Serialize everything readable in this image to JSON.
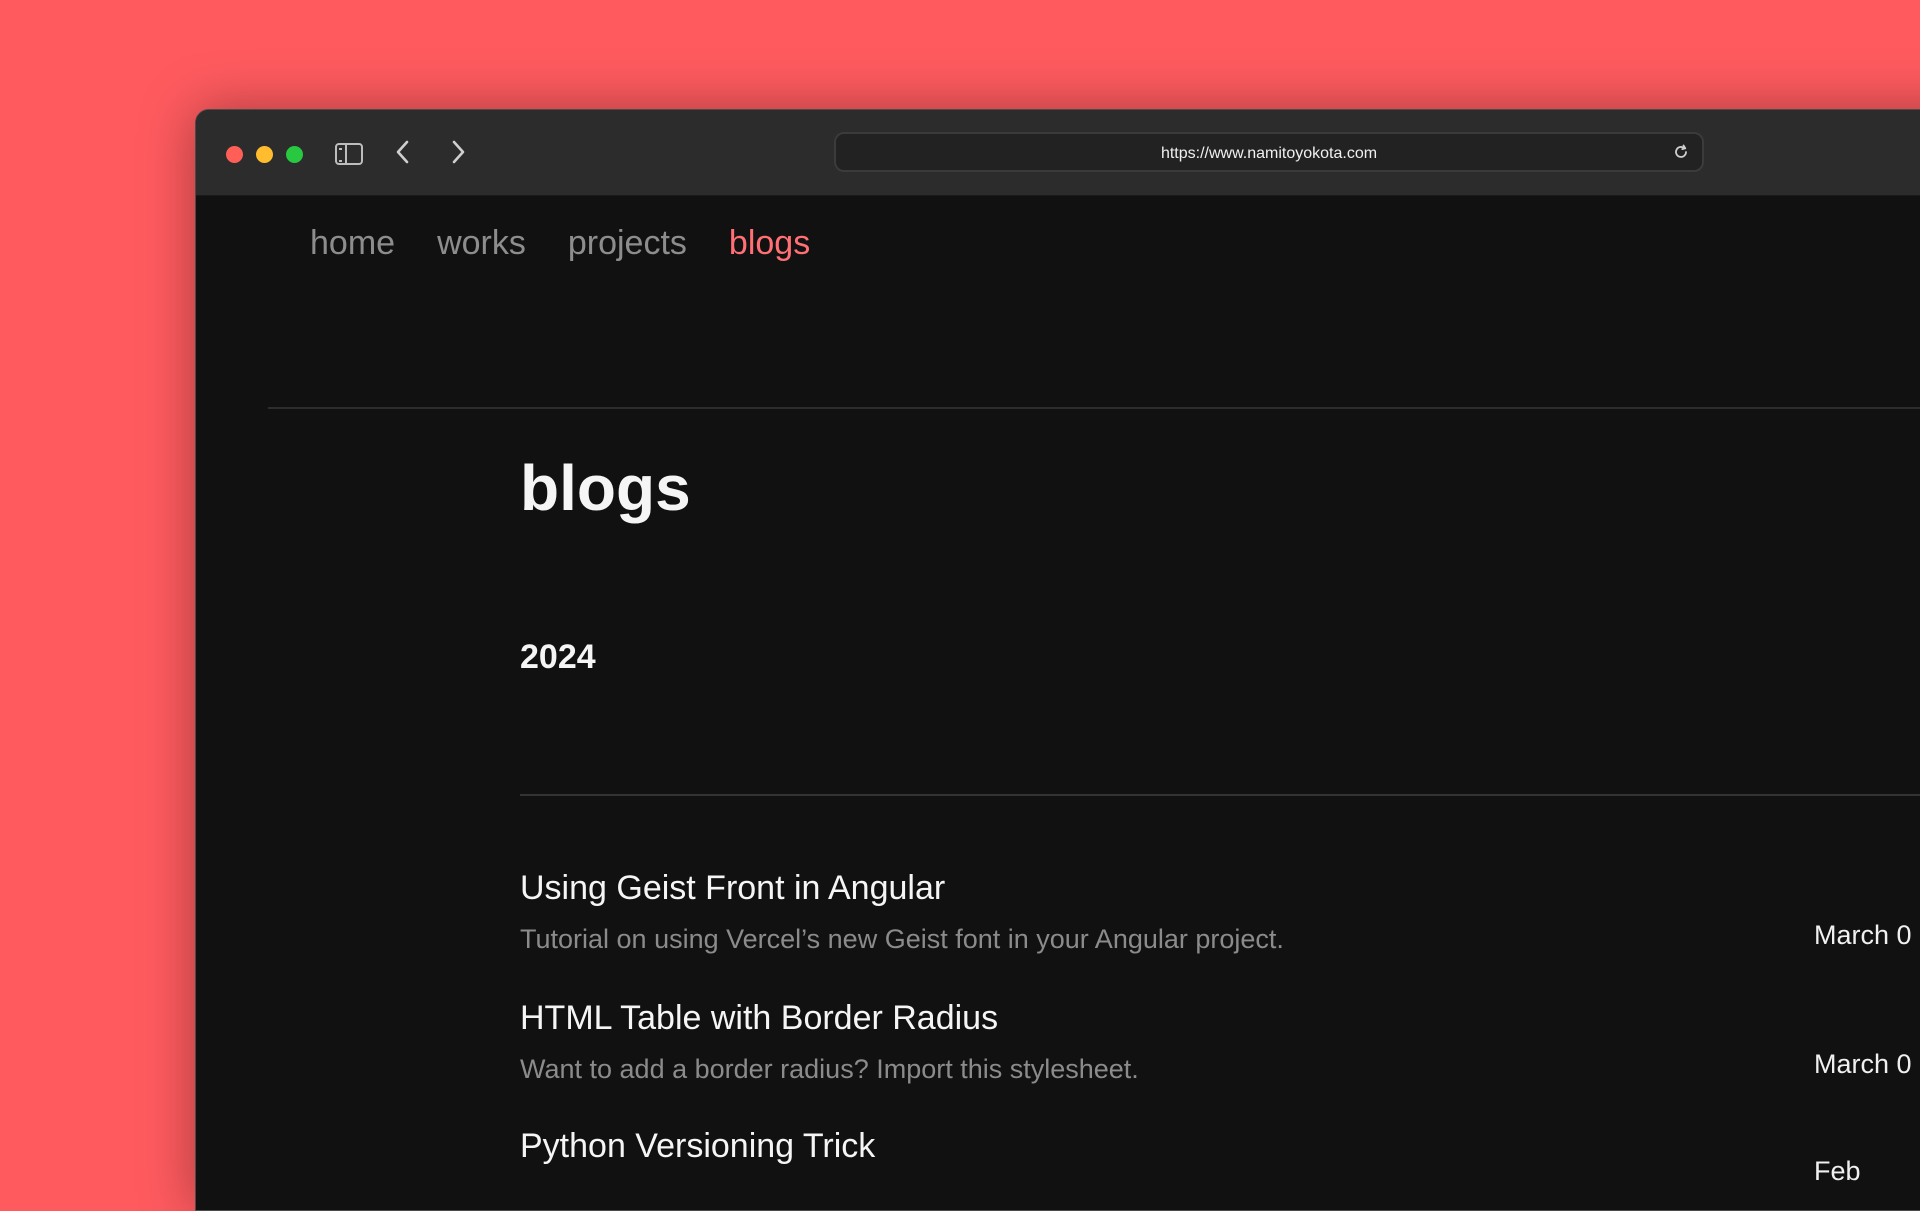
{
  "browser": {
    "url": "https://www.namitoyokota.com",
    "icons": [
      "sidebar-icon",
      "back-icon",
      "forward-icon",
      "reload-icon"
    ]
  },
  "nav": {
    "items": [
      {
        "label": "home"
      },
      {
        "label": "works"
      },
      {
        "label": "projects"
      },
      {
        "label": "blogs"
      }
    ],
    "active": "blogs"
  },
  "page": {
    "title": "blogs",
    "year": "2024"
  },
  "posts": [
    {
      "title": "Using Geist Front in Angular",
      "description": "Tutorial on using Vercel’s new Geist font in your Angular project.",
      "date": "March 0"
    },
    {
      "title": "HTML Table with Border Radius",
      "description": "Want to add a border radius? Import this stylesheet.",
      "date": "March 0"
    },
    {
      "title": "Python Versioning Trick",
      "description": "",
      "date": "Feb"
    }
  ],
  "colors": {
    "background": "#ff5b5f",
    "page": "#111111",
    "active_nav": "#ff6f73",
    "muted_nav": "#8d8d8d"
  }
}
